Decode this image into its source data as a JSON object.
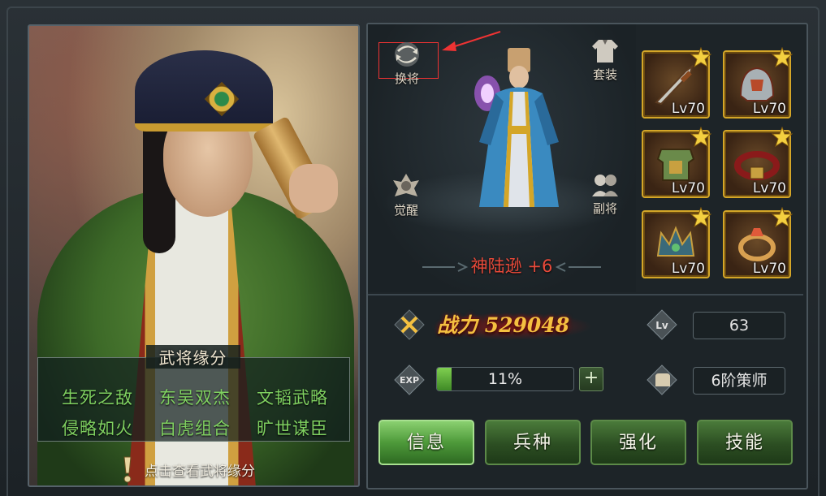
{
  "left_panel": {
    "fate_title": "武将缘分",
    "fates": [
      "生死之敌",
      "东吴双杰",
      "文韬武略",
      "侵略如火",
      "白虎组合",
      "旷世谋臣"
    ],
    "hint": "点击查看武将缘分"
  },
  "hero": {
    "name": "神陆逊 +6"
  },
  "buttons": {
    "swap": "换将",
    "outfit": "套装",
    "awaken": "觉醒",
    "deputy": "副将"
  },
  "equipment": [
    {
      "level": "Lv70",
      "icon": "sword-icon"
    },
    {
      "level": "Lv70",
      "icon": "helmet-icon"
    },
    {
      "level": "Lv70",
      "icon": "armor-icon"
    },
    {
      "level": "Lv70",
      "icon": "belt-icon"
    },
    {
      "level": "Lv70",
      "icon": "crown-icon"
    },
    {
      "level": "Lv70",
      "icon": "ring-icon"
    }
  ],
  "stats": {
    "power_label": "战力",
    "power_value": "529048",
    "lv_icon_text": "Lv",
    "level": "63",
    "exp_icon_text": "EXP",
    "exp_percent": "11%",
    "exp_fraction": 0.11,
    "rank": "6阶策师"
  },
  "tabs": [
    {
      "label": "信息",
      "active": true
    },
    {
      "label": "兵种",
      "active": false
    },
    {
      "label": "强化",
      "active": false
    },
    {
      "label": "技能",
      "active": false
    }
  ],
  "colors": {
    "accent_green": "#7fd060",
    "hero_name_red": "#ea4a3a",
    "power_gold": "#f4c040",
    "equip_border": "#d4a628"
  }
}
